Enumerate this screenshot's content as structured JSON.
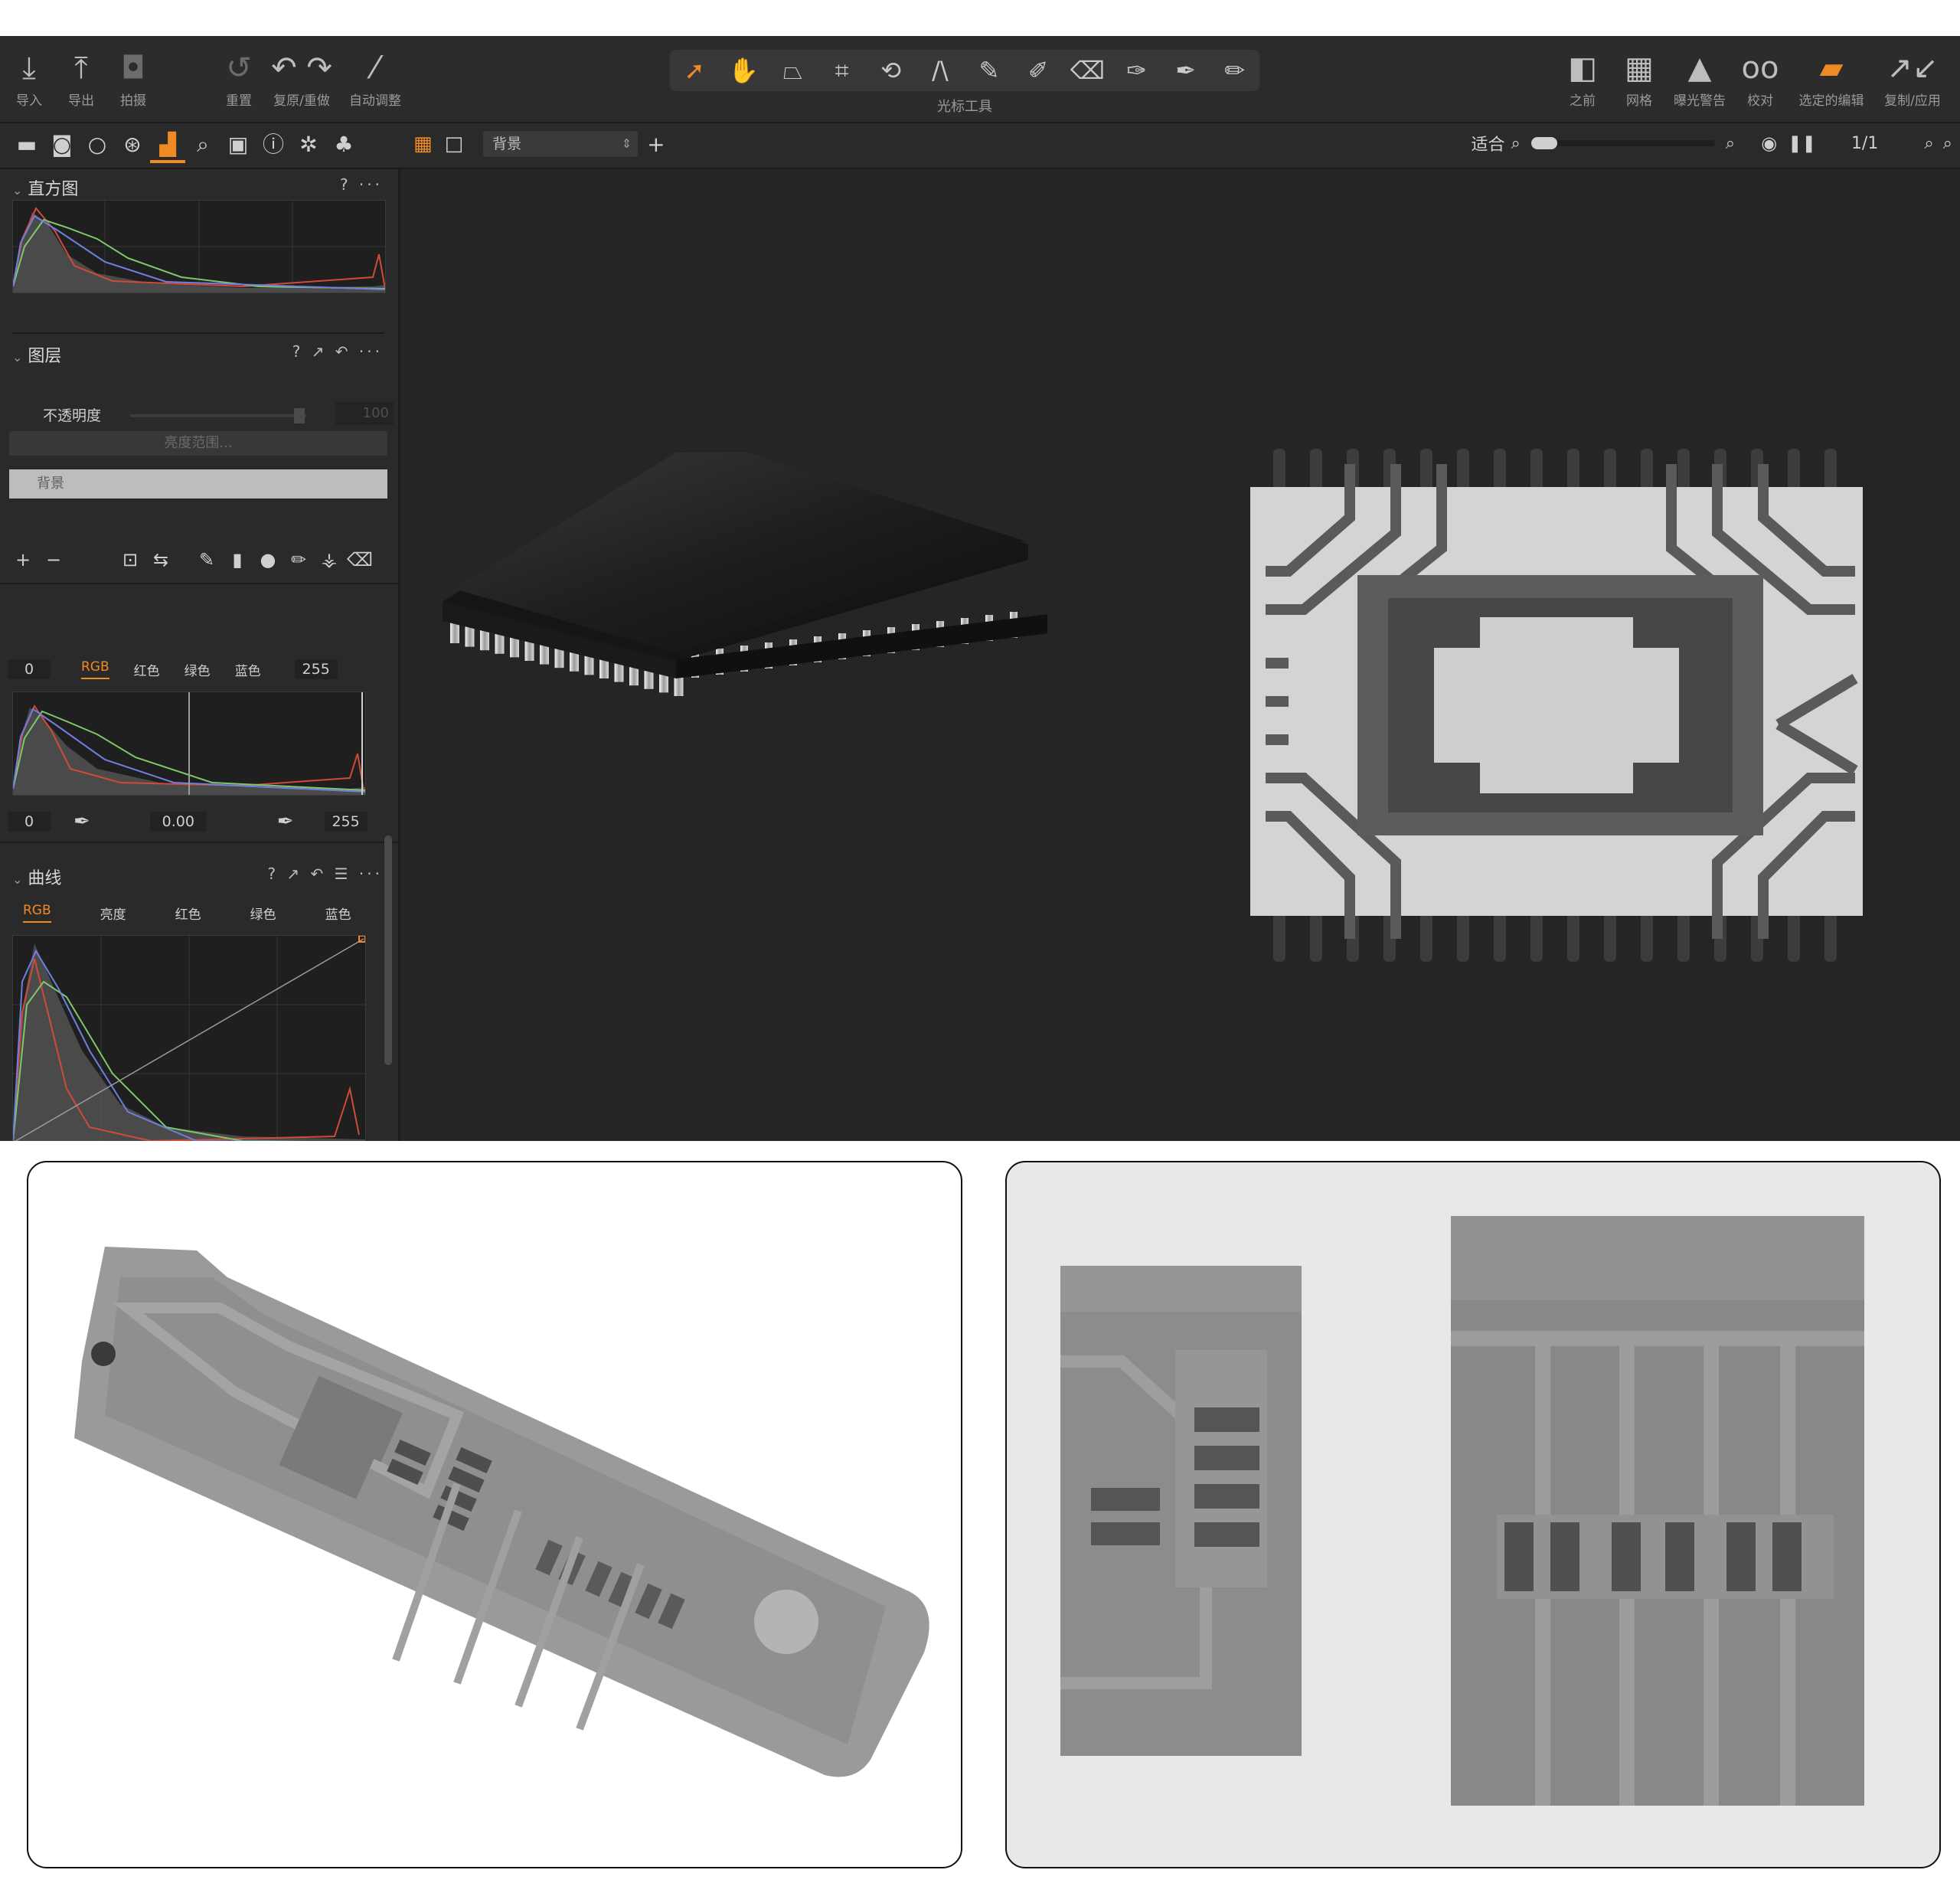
{
  "toolbar": {
    "left_buttons": [
      {
        "label": "导入",
        "icon": "download-icon"
      },
      {
        "label": "导出",
        "icon": "upload-icon"
      },
      {
        "label": "拍摄",
        "icon": "camera-icon"
      },
      {
        "label": "重置",
        "icon": "reset-icon"
      },
      {
        "label": "复原/重做",
        "icon": "undo-redo-icon"
      },
      {
        "label": "自动调整",
        "icon": "magic-wand-icon"
      }
    ],
    "cursor_tools_title": "光标工具",
    "right_buttons": [
      {
        "label": "之前",
        "icon": "before-after-icon"
      },
      {
        "label": "网格",
        "icon": "grid-icon"
      },
      {
        "label": "曝光警告",
        "icon": "warning-icon"
      },
      {
        "label": "校对",
        "icon": "glasses-icon"
      },
      {
        "label": "选定的编辑",
        "icon": "selected-edits-icon"
      },
      {
        "label": "复制/应用",
        "icon": "copy-apply-icon"
      }
    ]
  },
  "subbar": {
    "layer_select": "背景",
    "zoom_label": "适合",
    "page_count": "1/1"
  },
  "histogram": {
    "title": "直方图",
    "actions": "? ···"
  },
  "layers": {
    "title": "图层",
    "actions": "? ↗ ↶ ···",
    "opacity_label": "不透明度",
    "opacity_value": "100",
    "luminance_button": "亮度范围...",
    "layer_name": "背景"
  },
  "levels": {
    "input_low": "0",
    "input_high": "255",
    "channels": [
      "RGB",
      "红色",
      "绿色",
      "蓝色"
    ],
    "active_channel": "RGB",
    "output_low": "0",
    "midtone": "0.00",
    "output_high": "255"
  },
  "curves": {
    "title": "曲线",
    "actions": "? ↗ ↶ ☰ ···",
    "channels": [
      "RGB",
      "亮度",
      "红色",
      "绿色",
      "蓝色"
    ],
    "active_channel": "RGB"
  },
  "colors": {
    "accent": "#f08a24",
    "app_bg": "#252525",
    "panel_bg": "#2a2a2a"
  }
}
